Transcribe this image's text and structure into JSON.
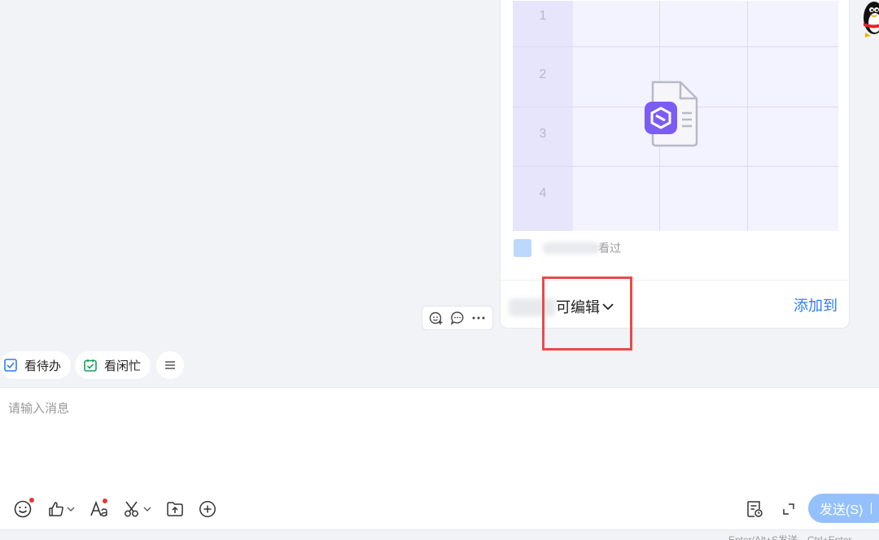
{
  "shared_doc": {
    "row_numbers": [
      "1",
      "2",
      "3",
      "4"
    ],
    "sent_text": "看过",
    "permission_label": "可编辑",
    "add_to_label": "添加到"
  },
  "quick_chips": {
    "todo_label": "看待办",
    "busy_label": "看闲忙"
  },
  "composer": {
    "placeholder": "请输入消息",
    "value": "",
    "send_label": "发送(S)",
    "hint": "Enter/Alt+S发送，Ctrl+Enter"
  },
  "icons": {
    "toolbar": [
      "emoji-icon",
      "thumbs-up-icon",
      "font-icon",
      "scissors-icon",
      "upload-file-icon",
      "plus-circle-icon"
    ],
    "toolbar_right": [
      "history-icon",
      "expand-icon"
    ],
    "message_actions": [
      "add-reaction-icon",
      "comment-icon",
      "more-icon"
    ]
  },
  "colors": {
    "accent": "#2e7cf6",
    "doc_purple": "#7b5cf5",
    "send_button": "#94c1fb",
    "highlight": "#e94a4a",
    "notification_dot": "#e53935"
  }
}
